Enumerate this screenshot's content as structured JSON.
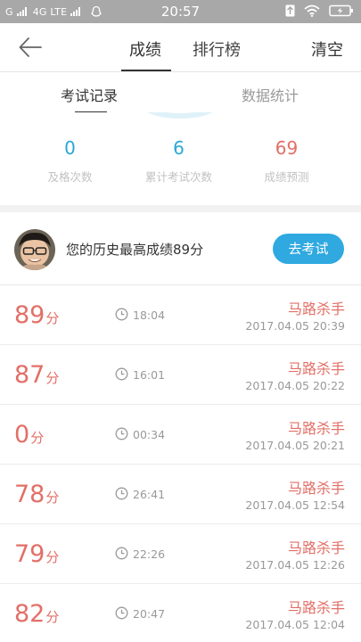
{
  "status_bar": {
    "carrier": "G",
    "network": "4G LTE",
    "time": "20:57",
    "icons": [
      "signal-icon",
      "qq-icon",
      "sim-icon",
      "wifi-icon",
      "battery-icon"
    ]
  },
  "header": {
    "back_icon": "arrow-left-icon",
    "tabs": [
      {
        "label": "成绩",
        "active": true
      },
      {
        "label": "排行榜",
        "active": false
      }
    ],
    "clear_label": "清空"
  },
  "subtabs": [
    {
      "label": "考试记录",
      "active": true
    },
    {
      "label": "数据统计",
      "active": false
    }
  ],
  "stats": [
    {
      "value": "0",
      "label": "及格次数",
      "color": "#29a7d8"
    },
    {
      "value": "6",
      "label": "累计考试次数",
      "color": "#29a7d8"
    },
    {
      "value": "69",
      "label": "成绩预测",
      "color": "#e26f67"
    }
  ],
  "best": {
    "text": "您的历史最高成绩89分",
    "button_label": "去考试"
  },
  "records": [
    {
      "score": "89",
      "unit": "分",
      "duration": "18:04",
      "user": "马路杀手",
      "datetime": "2017.04.05  20:39"
    },
    {
      "score": "87",
      "unit": "分",
      "duration": "16:01",
      "user": "马路杀手",
      "datetime": "2017.04.05  20:22"
    },
    {
      "score": "0",
      "unit": "分",
      "duration": "00:34",
      "user": "马路杀手",
      "datetime": "2017.04.05  20:21"
    },
    {
      "score": "78",
      "unit": "分",
      "duration": "26:41",
      "user": "马路杀手",
      "datetime": "2017.04.05  12:54"
    },
    {
      "score": "79",
      "unit": "分",
      "duration": "22:26",
      "user": "马路杀手",
      "datetime": "2017.04.05  12:26"
    },
    {
      "score": "82",
      "unit": "分",
      "duration": "20:47",
      "user": "马路杀手",
      "datetime": "2017.04.05  12:04"
    }
  ],
  "colors": {
    "accent_blue": "#2fa9e0",
    "score_red": "#e26f67",
    "status_bar": "#a8a8a8"
  }
}
